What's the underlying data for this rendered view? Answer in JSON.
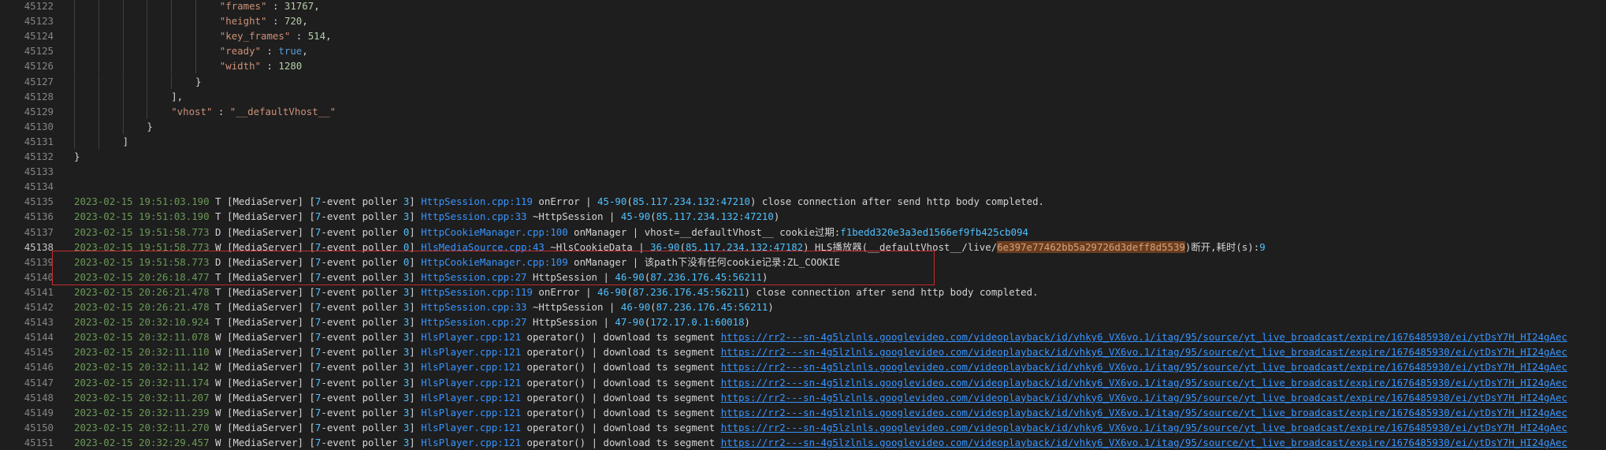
{
  "json_lines": [
    {
      "ln": "45122",
      "indent": 6,
      "k": "\"frames\"",
      "sep": " : ",
      "v": "31767",
      "vt": "num",
      "tail": ","
    },
    {
      "ln": "45123",
      "indent": 6,
      "k": "\"height\"",
      "sep": " : ",
      "v": "720",
      "vt": "num",
      "tail": ","
    },
    {
      "ln": "45124",
      "indent": 6,
      "k": "\"key_frames\"",
      "sep": " : ",
      "v": "514",
      "vt": "num",
      "tail": ","
    },
    {
      "ln": "45125",
      "indent": 6,
      "k": "\"ready\"",
      "sep": " : ",
      "v": "true",
      "vt": "kw",
      "tail": ","
    },
    {
      "ln": "45126",
      "indent": 6,
      "k": "\"width\"",
      "sep": " : ",
      "v": "1280",
      "vt": "num",
      "tail": ""
    },
    {
      "ln": "45127",
      "indent": 5,
      "k": "",
      "sep": "",
      "v": "}",
      "vt": "plain",
      "tail": ""
    },
    {
      "ln": "45128",
      "indent": 4,
      "k": "",
      "sep": "",
      "v": "],",
      "vt": "plain",
      "tail": ""
    },
    {
      "ln": "45129",
      "indent": 4,
      "k": "\"vhost\"",
      "sep": " : ",
      "v": "\"__defaultVhost__\"",
      "vt": "str",
      "tail": ""
    },
    {
      "ln": "45130",
      "indent": 3,
      "k": "",
      "sep": "",
      "v": "}",
      "vt": "plain",
      "tail": ""
    },
    {
      "ln": "45131",
      "indent": 2,
      "k": "",
      "sep": "",
      "v": "]",
      "vt": "plain",
      "tail": ""
    },
    {
      "ln": "45132",
      "indent": 0,
      "k": "",
      "sep": "",
      "v": "}",
      "vt": "plain",
      "tail": ""
    },
    {
      "ln": "45133",
      "indent": 0,
      "k": "",
      "sep": "",
      "v": "",
      "vt": "plain",
      "tail": ""
    },
    {
      "ln": "45134",
      "indent": 0,
      "k": "",
      "sep": "",
      "v": "",
      "vt": "plain",
      "tail": ""
    }
  ],
  "log_lines": [
    {
      "ln": "45135",
      "ts": "2023-02-15 19:51:03.190",
      "lvl": "T",
      "poller": "3",
      "file": "HttpSession.cpp:119",
      "rest_pre": " onError | ",
      "sid": "45-90",
      "ip": "85.117.234.132:47210",
      "msg": ") close connection after send http body completed.",
      "active": false
    },
    {
      "ln": "45136",
      "ts": "2023-02-15 19:51:03.190",
      "lvl": "T",
      "poller": "3",
      "file": "HttpSession.cpp:33",
      "rest_pre": " ~HttpSession | ",
      "sid": "45-90",
      "ip": "85.117.234.132:47210",
      "msg": ")",
      "active": false
    },
    {
      "ln": "45137",
      "ts": "2023-02-15 19:51:58.773",
      "lvl": "D",
      "poller": "0",
      "file": "HttpCookieManager.cpp:100",
      "rest_pre": " onManager | vhost=__defaultVhost__ cookie过期:",
      "sid": "",
      "ip": "",
      "msg": "",
      "hexid": "f1bedd320e3a3ed1566ef9fb425cb094",
      "active": false
    },
    {
      "ln": "45138",
      "ts": "2023-02-15 19:51:58.773",
      "lvl": "W",
      "poller": "0",
      "file": "HlsMediaSource.cpp:43",
      "rest_pre": " ~HlsCookieData | ",
      "sid": "36-90",
      "ip": "85.117.234.132:47182",
      "msg": ") HLS播放器(__defaultVhost__/live/",
      "sel": "6e397e77462bb5a29726d3deff8d5539",
      "msg2": ")断开,耗时(s):",
      "num2": "9",
      "active": true
    },
    {
      "ln": "45139",
      "ts": "2023-02-15 19:51:58.773",
      "lvl": "D",
      "poller": "0",
      "file": "HttpCookieManager.cpp:109",
      "rest_pre": " onManager | 该path下没有任何cookie记录:ZL_COOKIE",
      "sid": "",
      "ip": "",
      "msg": "",
      "active": false
    },
    {
      "ln": "45140",
      "ts": "2023-02-15 20:26:18.477",
      "lvl": "T",
      "poller": "3",
      "file": "HttpSession.cpp:27",
      "rest_pre": " HttpSession | ",
      "sid": "46-90",
      "ip": "87.236.176.45:56211",
      "msg": ")",
      "active": false
    },
    {
      "ln": "45141",
      "ts": "2023-02-15 20:26:21.478",
      "lvl": "T",
      "poller": "3",
      "file": "HttpSession.cpp:119",
      "rest_pre": " onError | ",
      "sid": "46-90",
      "ip": "87.236.176.45:56211",
      "msg": ") close connection after send http body completed.",
      "active": false
    },
    {
      "ln": "45142",
      "ts": "2023-02-15 20:26:21.478",
      "lvl": "T",
      "poller": "3",
      "file": "HttpSession.cpp:33",
      "rest_pre": " ~HttpSession | ",
      "sid": "46-90",
      "ip": "87.236.176.45:56211",
      "msg": ")",
      "active": false
    },
    {
      "ln": "45143",
      "ts": "2023-02-15 20:32:10.924",
      "lvl": "T",
      "poller": "3",
      "file": "HttpSession.cpp:27",
      "rest_pre": " HttpSession | ",
      "sid": "47-90",
      "ip": "172.17.0.1:60018",
      "msg": ")",
      "active": false
    },
    {
      "ln": "45144",
      "ts": "2023-02-15 20:32:11.078",
      "lvl": "W",
      "poller": "3",
      "file": "HlsPlayer.cpp:121",
      "rest_pre": " operator() | download ts segment ",
      "url": "https://rr2---sn-4g5lzlnls.googlevideo.com/videoplayback/id/vhky6_VX6vo.1/itag/95/source/yt_live_broadcast/expire/1676485930/ei/ytDsY7H_HI24gAec",
      "active": false
    },
    {
      "ln": "45145",
      "ts": "2023-02-15 20:32:11.110",
      "lvl": "W",
      "poller": "3",
      "file": "HlsPlayer.cpp:121",
      "rest_pre": " operator() | download ts segment ",
      "url": "https://rr2---sn-4g5lzlnls.googlevideo.com/videoplayback/id/vhky6_VX6vo.1/itag/95/source/yt_live_broadcast/expire/1676485930/ei/ytDsY7H_HI24gAec",
      "active": false
    },
    {
      "ln": "45146",
      "ts": "2023-02-15 20:32:11.142",
      "lvl": "W",
      "poller": "3",
      "file": "HlsPlayer.cpp:121",
      "rest_pre": " operator() | download ts segment ",
      "url": "https://rr2---sn-4g5lzlnls.googlevideo.com/videoplayback/id/vhky6_VX6vo.1/itag/95/source/yt_live_broadcast/expire/1676485930/ei/ytDsY7H_HI24gAec",
      "active": false
    },
    {
      "ln": "45147",
      "ts": "2023-02-15 20:32:11.174",
      "lvl": "W",
      "poller": "3",
      "file": "HlsPlayer.cpp:121",
      "rest_pre": " operator() | download ts segment ",
      "url": "https://rr2---sn-4g5lzlnls.googlevideo.com/videoplayback/id/vhky6_VX6vo.1/itag/95/source/yt_live_broadcast/expire/1676485930/ei/ytDsY7H_HI24gAec",
      "active": false
    },
    {
      "ln": "45148",
      "ts": "2023-02-15 20:32:11.207",
      "lvl": "W",
      "poller": "3",
      "file": "HlsPlayer.cpp:121",
      "rest_pre": " operator() | download ts segment ",
      "url": "https://rr2---sn-4g5lzlnls.googlevideo.com/videoplayback/id/vhky6_VX6vo.1/itag/95/source/yt_live_broadcast/expire/1676485930/ei/ytDsY7H_HI24gAec",
      "active": false
    },
    {
      "ln": "45149",
      "ts": "2023-02-15 20:32:11.239",
      "lvl": "W",
      "poller": "3",
      "file": "HlsPlayer.cpp:121",
      "rest_pre": " operator() | download ts segment ",
      "url": "https://rr2---sn-4g5lzlnls.googlevideo.com/videoplayback/id/vhky6_VX6vo.1/itag/95/source/yt_live_broadcast/expire/1676485930/ei/ytDsY7H_HI24gAec",
      "active": false
    },
    {
      "ln": "45150",
      "ts": "2023-02-15 20:32:11.270",
      "lvl": "W",
      "poller": "3",
      "file": "HlsPlayer.cpp:121",
      "rest_pre": " operator() | download ts segment ",
      "url": "https://rr2---sn-4g5lzlnls.googlevideo.com/videoplayback/id/vhky6_VX6vo.1/itag/95/source/yt_live_broadcast/expire/1676485930/ei/ytDsY7H_HI24gAec",
      "active": false
    },
    {
      "ln": "45151",
      "ts": "2023-02-15 20:32:29.457",
      "lvl": "W",
      "poller": "3",
      "file": "HlsPlayer.cpp:121",
      "rest_pre": " operator() | download ts segment ",
      "url": "https://rr2---sn-4g5lzlnls.googlevideo.com/videoplayback/id/vhky6_VX6vo.1/itag/95/source/yt_live_broadcast/expire/1676485930/ei/ytDsY7H_HI24gAec",
      "active": false
    }
  ],
  "log_text": {
    "server": "[MediaServer]",
    "poller_pre": "[",
    "poller_num": "7",
    "poller_mid": "-event poller ",
    "poller_post": "]"
  },
  "colors": {
    "background": "#1e1e1e",
    "timestamp": "#6a9955",
    "link": "#3794ff",
    "number": "#b5cea8",
    "highlight_box": "#c62b2b"
  }
}
